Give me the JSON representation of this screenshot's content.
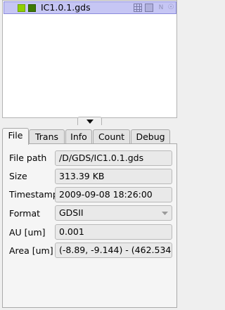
{
  "layers": {
    "items": [
      {
        "name": "IC1.0.1.gds",
        "swatch_colors": [
          "#8fd000",
          "#3d7a00"
        ],
        "row_icons": [
          "grid-icon",
          "box-icon",
          "n-icon",
          "bulb-icon"
        ]
      }
    ],
    "n_glyph": "N",
    "bulb_glyph": "☉"
  },
  "splitter": {
    "icon": "chevron-down-icon"
  },
  "tabs": [
    {
      "label": "File",
      "active": true
    },
    {
      "label": "Trans",
      "active": false
    },
    {
      "label": "Info",
      "active": false
    },
    {
      "label": "Count",
      "active": false
    },
    {
      "label": "Debug",
      "active": false
    }
  ],
  "file_info": {
    "path_label": "File path",
    "path_value": "/D/GDS/IC1.0.1.gds",
    "size_label": "Size",
    "size_value": "313.39 KB",
    "timestamp_label": "Timestamp",
    "timestamp_value": "2009-09-08 18:26:00",
    "format_label": "Format",
    "format_value": "GDSII",
    "au_label": "AU [um]",
    "au_value": "0.001",
    "area_label": "Area [um]",
    "area_value": "(-8.89, -9.144) - (462.534,"
  }
}
